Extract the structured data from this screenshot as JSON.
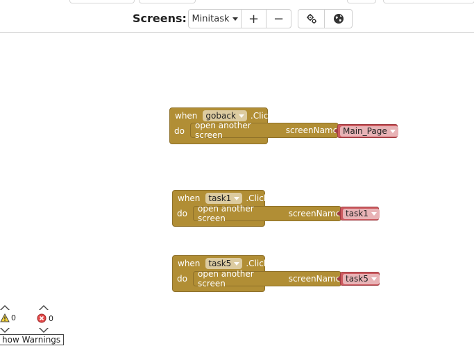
{
  "toolbar": {
    "screens_label": "Screens:",
    "screen_select": "Minitask",
    "add_screen": "+",
    "remove_screen": "−",
    "settings_icon": "gear-icon",
    "language_icon": "globe-icon"
  },
  "blocks": [
    {
      "when": "when",
      "component": "goback",
      "event": ".Click",
      "do": "do",
      "action": "open another screen",
      "param": "screenName",
      "value": "Main_Page"
    },
    {
      "when": "when",
      "component": "task1",
      "event": ".Click",
      "do": "do",
      "action": "open another screen",
      "param": "screenName",
      "value": "task1"
    },
    {
      "when": "when",
      "component": "task5",
      "event": ".Click",
      "do": "do",
      "action": "open another screen",
      "param": "screenName",
      "value": "task5"
    }
  ],
  "status": {
    "warnings_count": "0",
    "errors_count": "0",
    "show_warnings": "how Warnings"
  },
  "colors": {
    "event_block": "#b18e35",
    "text_block": "#cc5a5f"
  }
}
